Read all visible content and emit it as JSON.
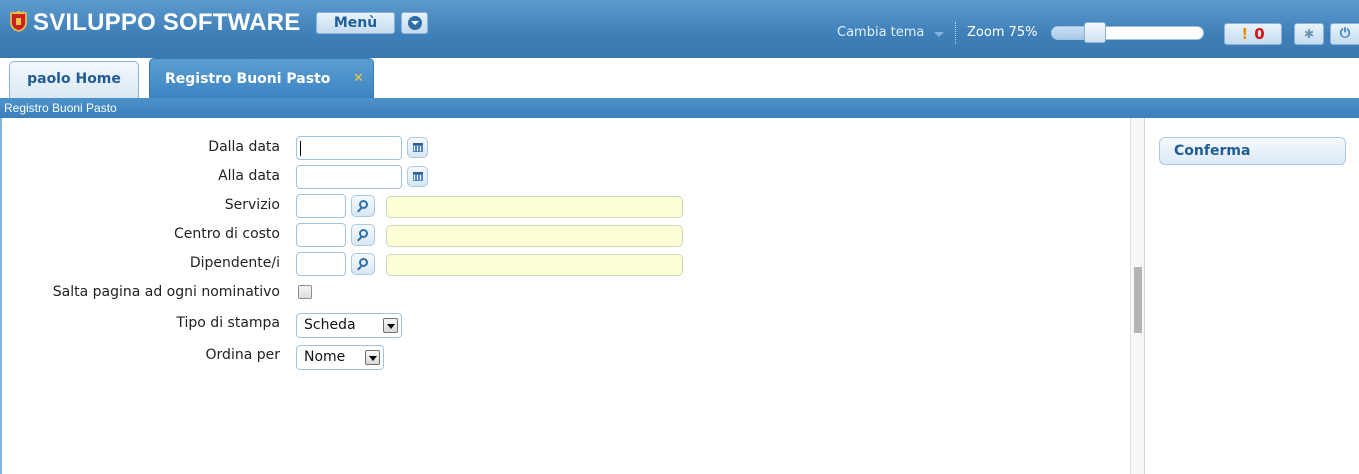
{
  "header": {
    "app_title": "SVILUPPO SOFTWARE",
    "menu_label": "Menù",
    "theme_label": "Cambia tema",
    "zoom_label": "Zoom 75%",
    "zoom_level": 0.33,
    "notifications_mark": "!",
    "notifications_count": "0",
    "colors": {
      "header_blue": "#3f7fb8",
      "notification_red": "#d41414"
    }
  },
  "tabs": [
    {
      "label": "paolo Home",
      "active": false
    },
    {
      "label": "Registro Buoni Pasto",
      "active": true,
      "close_icon": "close-icon"
    }
  ],
  "breadcrumb": "Registro Buoni Pasto",
  "form": {
    "date_from": {
      "label": "Dalla data",
      "value": ""
    },
    "date_to": {
      "label": "Alla data",
      "value": ""
    },
    "service": {
      "label": "Servizio",
      "code": "",
      "description": ""
    },
    "cost_center": {
      "label": "Centro di costo",
      "code": "",
      "description": ""
    },
    "employees": {
      "label": "Dipendente/i",
      "code": "",
      "description": ""
    },
    "page_break": {
      "label": "Salta pagina ad ogni nominativo",
      "checked": false
    },
    "print_type": {
      "label": "Tipo di stampa",
      "value": "Scheda"
    },
    "order_by": {
      "label": "Ordina per",
      "value": "Nome"
    }
  },
  "side": {
    "confirm_label": "Conferma"
  }
}
